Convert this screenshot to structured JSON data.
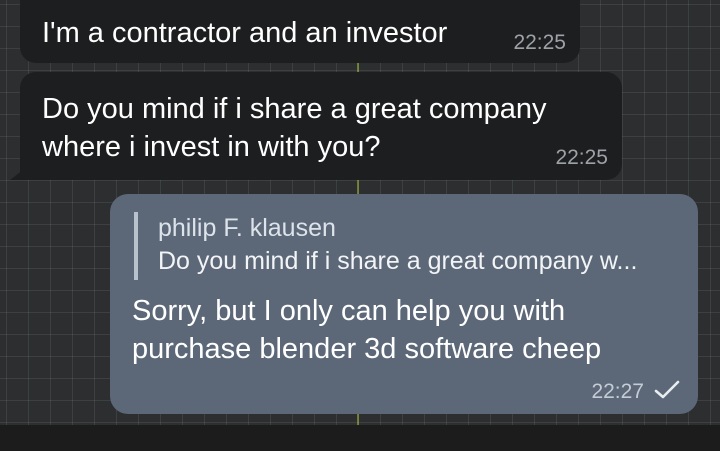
{
  "messages": {
    "incoming_1": {
      "text": "I'm a contractor and an investor",
      "time": "22:25"
    },
    "incoming_2": {
      "text_line1": "Do you mind if i share a great company",
      "text_line2": "where i invest in with you?",
      "time": "22:25"
    },
    "outgoing_1": {
      "reply": {
        "author": "philip F. klausen",
        "snippet": "Do you mind if i share a great company w..."
      },
      "text_line1": "Sorry, but I only can help you with",
      "text_line2": "purchase blender 3d software cheep",
      "time": "22:27",
      "status_icon": "check-icon"
    }
  },
  "colors": {
    "incoming_bubble": "#1d1e20",
    "outgoing_bubble": "#5c6878",
    "chat_background": "#2c2e30"
  }
}
